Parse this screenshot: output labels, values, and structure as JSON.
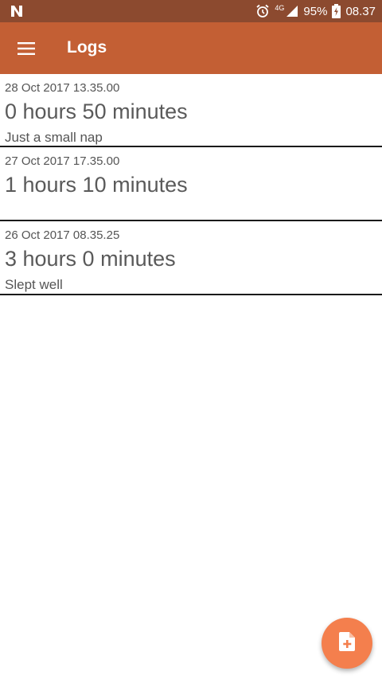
{
  "status_bar": {
    "carrier_icon": "n-notification-icon",
    "alarm_icon": "alarm-icon",
    "network": "4G",
    "signal_icon": "signal-icon",
    "battery": "95%",
    "battery_icon": "battery-charging-icon",
    "time": "08.37",
    "background_color": "#8c4a2f"
  },
  "app_bar": {
    "menu_icon": "hamburger-menu-icon",
    "title": "Logs",
    "background_color": "#c35f34"
  },
  "logs": [
    {
      "date": "28 Oct 2017 13.35.00",
      "duration": "0 hours 50 minutes",
      "note": "Just a small nap"
    },
    {
      "date": "27 Oct 2017 17.35.00",
      "duration": "1 hours 10 minutes",
      "note": ""
    },
    {
      "date": "26 Oct 2017 08.35.25",
      "duration": "3 hours 0 minutes",
      "note": "Slept well"
    }
  ],
  "fab": {
    "icon": "add-document-icon",
    "color": "#f47f4d"
  }
}
